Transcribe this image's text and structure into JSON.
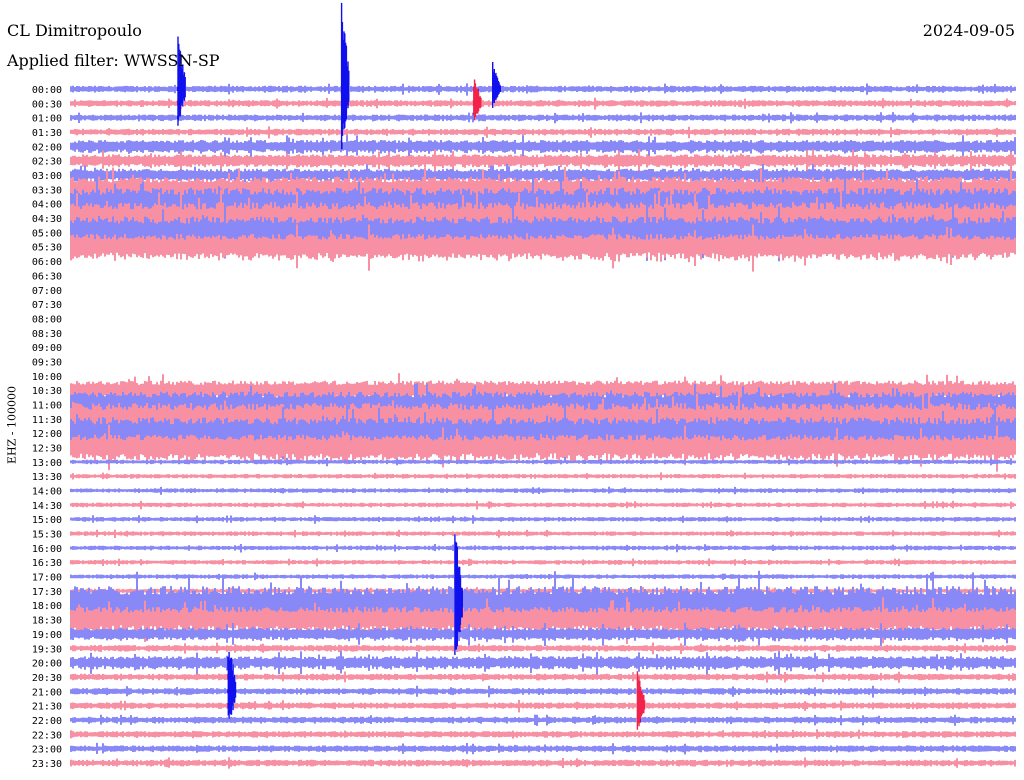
{
  "header": {
    "station": "CL Dimitropoulo",
    "filter_label": "Applied filter: WWSSN-SP",
    "date": "2024-09-05"
  },
  "axis": {
    "ylabel": "EHZ - 100000"
  },
  "colors": {
    "trace_a": "#1010ee",
    "trace_b": "#f2224a",
    "background": "#ffffff"
  },
  "chart_data": {
    "type": "helicorder",
    "title": "CL Dimitropoulo",
    "subtitle": "Applied filter: WWSSN-SP",
    "date": "2024-09-05",
    "ylabel": "EHZ - 100000",
    "rows": [
      "00:00",
      "00:30",
      "01:00",
      "01:30",
      "02:00",
      "02:30",
      "03:00",
      "03:30",
      "04:00",
      "04:30",
      "05:00",
      "05:30",
      "06:00",
      "06:30",
      "07:00",
      "07:30",
      "08:00",
      "08:30",
      "09:00",
      "09:30",
      "10:00",
      "10:30",
      "11:00",
      "11:30",
      "12:00",
      "12:30",
      "13:00",
      "13:30",
      "14:00",
      "14:30",
      "15:00",
      "15:30",
      "16:00",
      "16:30",
      "17:00",
      "17:30",
      "18:00",
      "18:30",
      "19:00",
      "19:30",
      "20:00",
      "20:30",
      "21:00",
      "21:30",
      "22:00",
      "22:30",
      "23:00",
      "23:30"
    ],
    "line_minutes": 30,
    "trace_colors": [
      "blue",
      "red"
    ],
    "data_rows": [
      0,
      1,
      2,
      3,
      4,
      5,
      6,
      7,
      8,
      9,
      10,
      11,
      21,
      22,
      23,
      24,
      25,
      26,
      27,
      28,
      29,
      30,
      31,
      32,
      33,
      34,
      35,
      36,
      37,
      38,
      39,
      40,
      41,
      42,
      43,
      44,
      45,
      46,
      47
    ],
    "gap_rows": [
      12,
      13,
      14,
      15,
      16,
      17,
      18,
      19,
      20
    ],
    "amplitude_levels": [
      1,
      1,
      1,
      1,
      2,
      2,
      2,
      4,
      5,
      5,
      5,
      4,
      0,
      0,
      0,
      0,
      0,
      0,
      0,
      0,
      0,
      3,
      4,
      5,
      5,
      4,
      0,
      0,
      0,
      0,
      0,
      0,
      0,
      0,
      0,
      0,
      6,
      4,
      2,
      1,
      2,
      1,
      1,
      1,
      1,
      1,
      1,
      1
    ],
    "events": [
      {
        "time": "00:00",
        "offset_min": 3.4,
        "strength": 6
      },
      {
        "time": "00:00",
        "offset_min": 8.6,
        "strength": 10
      },
      {
        "time": "00:00",
        "offset_min": 13.4,
        "strength": 3
      },
      {
        "time": "00:30",
        "offset_min": 12.8,
        "strength": 3
      },
      {
        "time": "18:00",
        "offset_min": 12.2,
        "strength": 9
      },
      {
        "time": "21:00",
        "offset_min": 5.0,
        "strength": 6
      },
      {
        "time": "21:30",
        "offset_min": 18.0,
        "strength": 4
      }
    ],
    "grid": false
  }
}
